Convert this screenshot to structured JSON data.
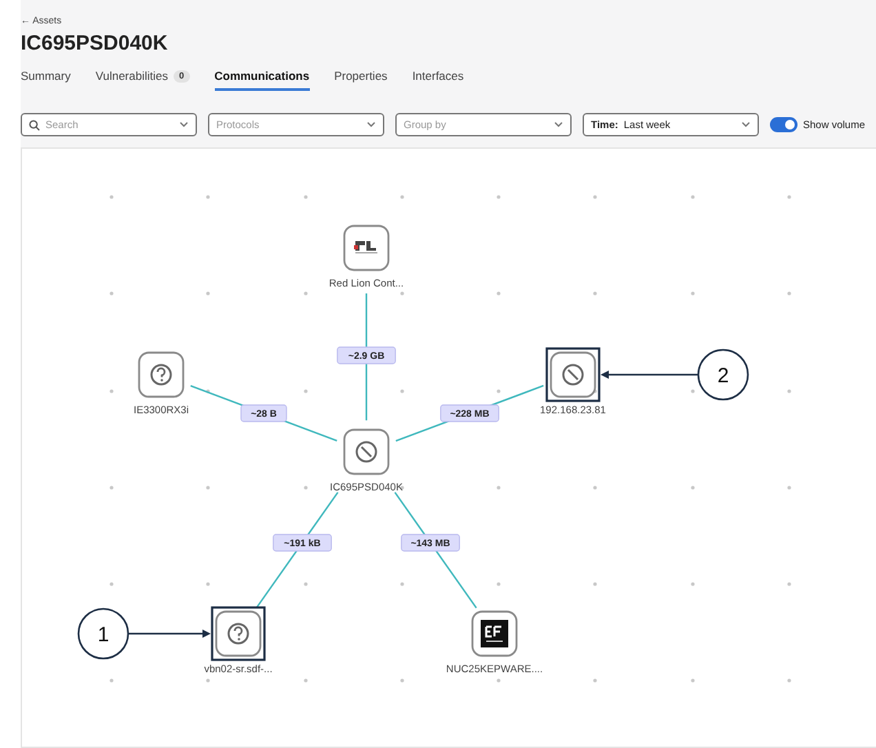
{
  "breadcrumb": {
    "arrow": "←",
    "label": "Assets"
  },
  "title": "IC695PSD040K",
  "tabs": [
    {
      "label": "Summary",
      "selected": false
    },
    {
      "label": "Vulnerabilities",
      "badge": "0",
      "selected": false
    },
    {
      "label": "Communications",
      "selected": true
    },
    {
      "label": "Properties",
      "selected": false
    },
    {
      "label": "Interfaces",
      "selected": false
    }
  ],
  "filters": [
    {
      "kind": "search",
      "placeholder": "Search"
    },
    {
      "kind": "select",
      "placeholder": "Protocols"
    },
    {
      "kind": "select",
      "placeholder": "Group by"
    },
    {
      "kind": "select",
      "prefix": "Time:",
      "value": "Last week"
    }
  ],
  "show_volume": {
    "label": "Show volume",
    "on": true
  },
  "graph": {
    "nodes": [
      {
        "label": "Red Lion Cont...",
        "kind": "logo-rl",
        "highlighted": false
      },
      {
        "label": "IE3300RX3i",
        "kind": "unknown",
        "highlighted": false
      },
      {
        "label": "IC695PSD040K",
        "kind": "blocked",
        "highlighted": false
      },
      {
        "label": "192.168.23.81",
        "kind": "blocked",
        "highlighted": true,
        "callout": "2"
      },
      {
        "label": "vbn02-sr.sdf-...",
        "kind": "unknown",
        "highlighted": true,
        "callout": "1"
      },
      {
        "label": "NUC25KEPWARE....",
        "kind": "logo-efs",
        "highlighted": false
      }
    ],
    "edges": [
      {
        "volume": "~2.9 GB"
      },
      {
        "volume": "~28 B"
      },
      {
        "volume": "~228 MB"
      },
      {
        "volume": "~191 kB"
      },
      {
        "volume": "~143 MB"
      }
    ]
  }
}
